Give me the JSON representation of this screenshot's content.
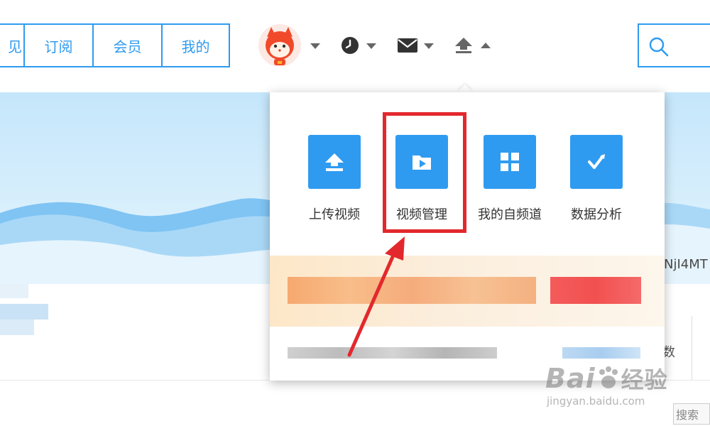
{
  "nav": {
    "tabs": [
      {
        "label": "见"
      },
      {
        "label": "订阅"
      },
      {
        "label": "会员"
      },
      {
        "label": "我的"
      }
    ]
  },
  "header_icons": [
    "avatar",
    "clock-icon",
    "mail-icon",
    "upload-icon",
    "search-icon"
  ],
  "dropdown": {
    "items": [
      {
        "label": "上传视频",
        "icon": "upload-icon"
      },
      {
        "label": "视频管理",
        "icon": "video-folder-icon"
      },
      {
        "label": "我的自频道",
        "icon": "grid-icon"
      },
      {
        "label": "数据分析",
        "icon": "chart-check-icon"
      }
    ]
  },
  "right_snippets": {
    "code": "NjI4MT",
    "word1": "数",
    "word2": "搜索"
  },
  "watermark": {
    "brand": "Bai",
    "brand2": "经验",
    "url": "jingyan.baidu.com"
  },
  "colors": {
    "accent": "#2f9bf0",
    "highlight": "#e3282d"
  }
}
